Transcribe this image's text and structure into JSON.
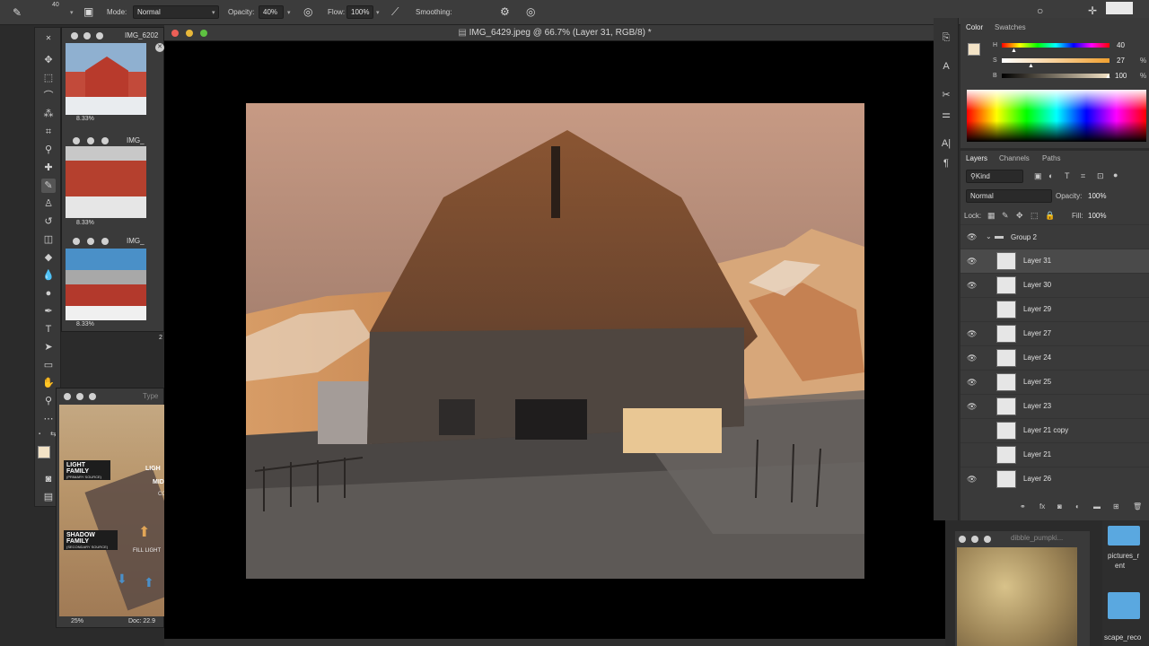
{
  "options_bar": {
    "brush_size": "40",
    "mode_label": "Mode:",
    "mode_value": "Normal",
    "opacity_label": "Opacity:",
    "opacity_value": "40%",
    "flow_label": "Flow:",
    "flow_value": "100%",
    "smoothing_label": "Smoothing:"
  },
  "documents": {
    "main_title": "IMG_6429.jpeg @ 66.7% (Layer 31, RGB/8) *",
    "thumb1_title": "IMG_6202",
    "thumb1_zoom": "8.33%",
    "thumb2_title": "IMG_",
    "thumb2_zoom": "8.33%",
    "thumb3_title": "IMG_",
    "thumb3_zoom": "8.33%",
    "ref_title": "Type",
    "ref_zoom": "25%",
    "ref_doc": "Doc: 22.9",
    "ref_text": {
      "light_family": "LIGHT FAMILY",
      "primary_source": "(PRIMARY SOURCE)",
      "shadow_family": "SHADOW FAMILY",
      "secondary_source": "(SECONDARY SOURCE)",
      "fill_light": "FILL LIGHT",
      "light_side": "LIGH",
      "mid_side": "MID",
      "co_side": "CO"
    },
    "small_num": "2",
    "bottom_thumb_title": "dibble_pumpki...",
    "finder_item1": "pictures_r",
    "finder_item1b": "ent",
    "finder_item2": "scape_reco"
  },
  "color_panel": {
    "tab_color": "Color",
    "tab_swatches": "Swatches",
    "h_label": "H",
    "s_label": "S",
    "b_label": "B",
    "h_value": "40",
    "s_value": "27",
    "b_value": "100",
    "unit": "%",
    "fg_color": "#f3e3c6",
    "bg_color": "#ffffff"
  },
  "layers_panel": {
    "tab_layers": "Layers",
    "tab_channels": "Channels",
    "tab_paths": "Paths",
    "filter_kind": "Kind",
    "blend_mode": "Normal",
    "opacity_label": "Opacity:",
    "opacity_value": "100%",
    "lock_label": "Lock:",
    "fill_label": "Fill:",
    "fill_value": "100%",
    "group_name": "Group 2",
    "layers": [
      {
        "name": "Layer 31",
        "visible": true
      },
      {
        "name": "Layer 30",
        "visible": true
      },
      {
        "name": "Layer 29",
        "visible": false
      },
      {
        "name": "Layer 27",
        "visible": true
      },
      {
        "name": "Layer 24",
        "visible": true
      },
      {
        "name": "Layer 25",
        "visible": true
      },
      {
        "name": "Layer 23",
        "visible": true
      },
      {
        "name": "Layer 21 copy",
        "visible": false
      },
      {
        "name": "Layer 21",
        "visible": false
      },
      {
        "name": "Layer 26",
        "visible": true
      }
    ]
  }
}
